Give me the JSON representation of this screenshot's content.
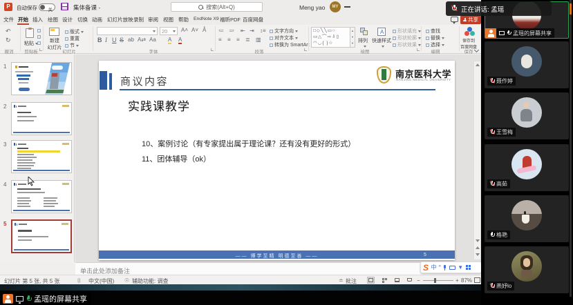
{
  "titlebar": {
    "autosave": "自动保存",
    "autosave_state": "关",
    "filename": "集体备课 -",
    "search_placeholder": "搜索(Alt+Q)",
    "user_name": "Meng yao",
    "user_initials": "MY"
  },
  "tabs": [
    "文件",
    "开始",
    "插入",
    "绘图",
    "设计",
    "切换",
    "动画",
    "幻灯片放映",
    "录制",
    "审阅",
    "视图",
    "帮助",
    "EndNote X9",
    "福昕PDF",
    "百度网盘"
  ],
  "ribbon": {
    "share": "共享",
    "groups": {
      "undo": "撤消",
      "clipboard": "剪贴板",
      "slides": "幻灯片",
      "font": "字体",
      "paragraph": "段落",
      "drawing": "绘图",
      "editing": "编辑",
      "save": "保存"
    },
    "paste": "粘贴",
    "new_slide_1": "新建",
    "new_slide_2": "幻灯片",
    "layout": "版式",
    "reset": "重置",
    "section": "节",
    "font_size": "20",
    "bold": "B",
    "italic": "I",
    "underline": "U",
    "strike": "S",
    "text_direction": "文字方向",
    "align_text": "对齐文本",
    "smartart": "转换为 SmartArt",
    "arrange": "排列",
    "quick_styles": "快速样式",
    "shape_fill": "形状填充",
    "shape_outline": "形状轮廓",
    "shape_effects": "形状效果",
    "find": "查找",
    "replace": "替换",
    "select": "选择",
    "baidu_1": "保存到",
    "baidu_2": "百度网盘",
    "shapes_row1": "□◇╲╲▭○",
    "shapes_row2": "▭△⌒⇨⇩▯",
    "shapes_row3": "◠◡{ }☆"
  },
  "thumbnails": {
    "numbers": [
      "1",
      "2",
      "3",
      "4",
      "5"
    ],
    "selected_index": 4
  },
  "slide": {
    "header_title": "商议内容",
    "logo_cn": "南京医科大学",
    "logo_en": "NANJING MEDICAL UNIVERSITY",
    "body_title": "实践课教学",
    "bullets": [
      "10、案例讨论（有专家提出属于理论课？还有没有更好的形式）",
      "11、团体辅导（ok）"
    ],
    "footer_motto": "——  博学至精  明德至善  ——",
    "footer_page": "5"
  },
  "notes": {
    "placeholder": "单击此处添加备注"
  },
  "statusbar": {
    "slide_info": "幻灯片 第 5 张, 共 5 张",
    "language": "中文(中国)",
    "accessibility": "辅助功能: 调查",
    "comments": "批注",
    "zoom_level": "87%"
  },
  "sogou": {
    "logo": "S",
    "mode": "中"
  },
  "meeting": {
    "speaking_banner": "正在讲话: 孟瑶",
    "share_badge_label": "孟瑶的屏幕共享",
    "participants": [
      {
        "name": "孟瑶的屏幕共享",
        "muted": false,
        "sharing": true
      },
      {
        "name": "聂作婷",
        "muted": true
      },
      {
        "name": "王雪梅",
        "muted": true
      },
      {
        "name": "高茹",
        "muted": true
      },
      {
        "name": "格艳",
        "muted": false
      },
      {
        "name": "燕妤lo",
        "muted": true
      }
    ]
  }
}
